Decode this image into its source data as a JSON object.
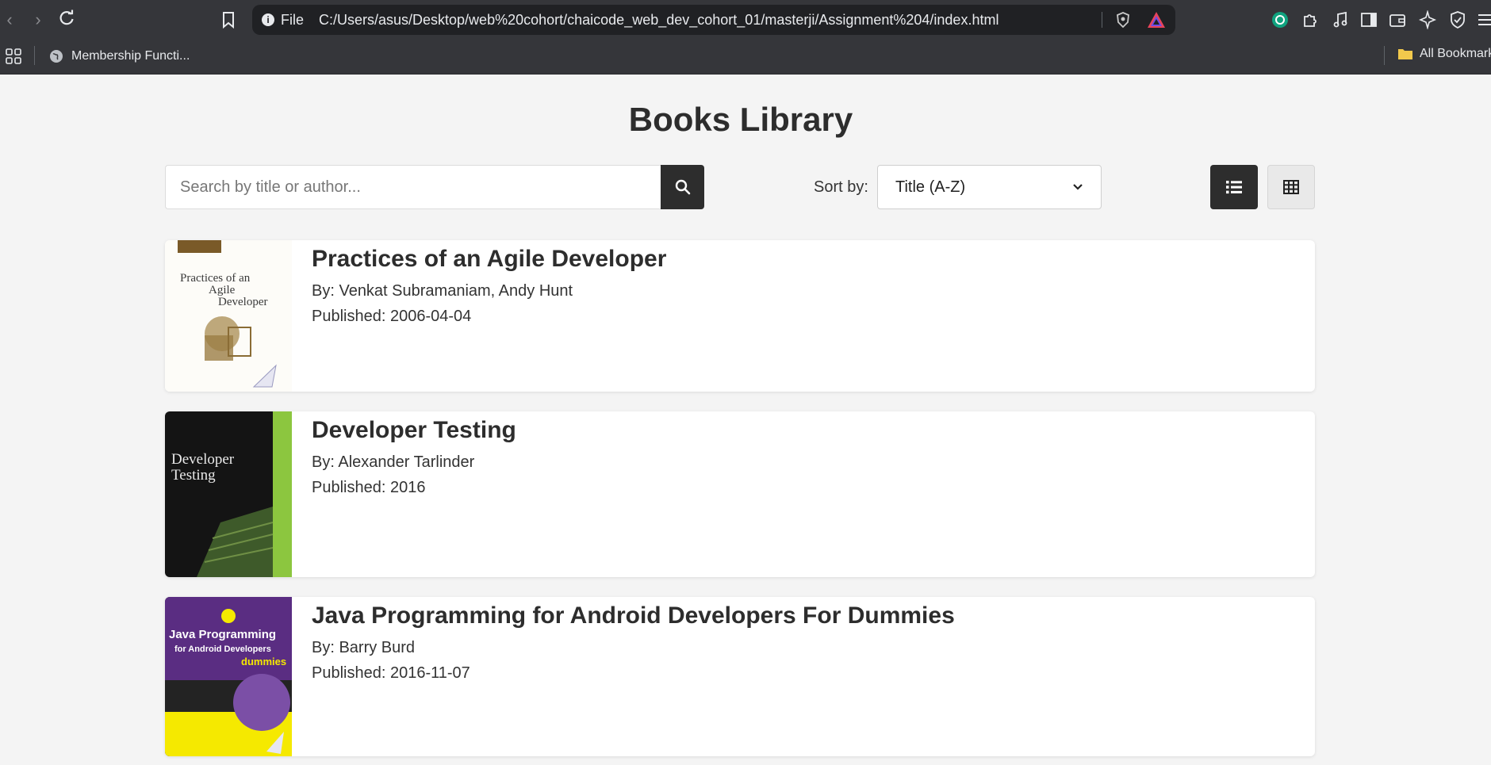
{
  "browser": {
    "scheme": "File",
    "url": "C:/Users/asus/Desktop/web%20cohort/chaicode_web_dev_cohort_01/masterji/Assignment%204/index.html",
    "bookmarks": [
      {
        "label": "Membership Functi..."
      }
    ],
    "all_bookmarks_label": "All Bookmarks"
  },
  "page": {
    "title": "Books Library",
    "search": {
      "placeholder": "Search by title or author...",
      "value": ""
    },
    "sort": {
      "label": "Sort by:",
      "selected": "Title (A-Z)"
    },
    "view_mode": "list"
  },
  "books": [
    {
      "title": "Practices of an Agile Developer",
      "authors": "By: Venkat Subramaniam, Andy Hunt",
      "published": "Published: 2006-04-04",
      "cover_text": [
        "Practices of an",
        "Agile",
        "Developer"
      ]
    },
    {
      "title": "Developer Testing",
      "authors": "By: Alexander Tarlinder",
      "published": "Published: 2016",
      "cover_text": [
        "Developer",
        "Testing"
      ]
    },
    {
      "title": "Java Programming for Android Developers For Dummies",
      "authors": "By: Barry Burd",
      "published": "Published: 2016-11-07",
      "cover_text": [
        "Java Programming",
        "for Android Developers",
        "dummies"
      ]
    }
  ],
  "colors": {
    "accent_dark": "#2d2d2d",
    "background": "#f4f4f4"
  }
}
